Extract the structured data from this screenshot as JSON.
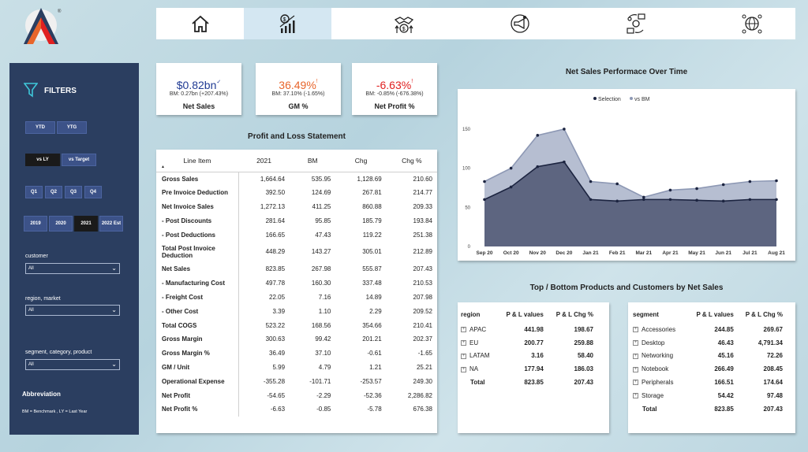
{
  "nav": {
    "items": [
      "home-icon",
      "finance-growth-icon",
      "handshake-growth-icon",
      "marketing-icon",
      "supply-chain-icon",
      "global-network-icon"
    ],
    "active_index": 1
  },
  "filters": {
    "title": "FILTERS",
    "period_buttons": [
      "YTD",
      "YTG"
    ],
    "compare_buttons": [
      "vs LY",
      "vs Target"
    ],
    "compare_selected": "vs LY",
    "quarter_buttons": [
      "Q1",
      "Q2",
      "Q3",
      "Q4"
    ],
    "year_buttons": [
      "2019",
      "2020",
      "2021",
      "2022 Est"
    ],
    "year_selected": "2021",
    "customer_label": "customer",
    "customer_value": "All",
    "region_label": "region, market",
    "region_value": "All",
    "segment_label": "segment, category, product",
    "segment_value": "All",
    "abbrev_title": "Abbreviation",
    "abbrev_text": "BM = Benchmark , LY = Last Year"
  },
  "kpis": [
    {
      "value": "$0.82bn",
      "mark": "✓",
      "bm": "BM: 0.27bn (+207.43%)",
      "label": "Net Sales",
      "color": "#1f3a93"
    },
    {
      "value": "36.49%",
      "mark": "!",
      "bm": "BM: 37.10% (-1.65%)",
      "label": "GM %",
      "color": "#e8652b"
    },
    {
      "value": "-6.63%",
      "mark": "!",
      "bm": "BM: -0.85% (-676.38%)",
      "label": "Net Profit %",
      "color": "#e02020"
    }
  ],
  "pl": {
    "title": "Profit and Loss  Statement",
    "headers": [
      "Line Item",
      "2021",
      "BM",
      "Chg",
      "Chg %"
    ],
    "rows": [
      [
        "Gross Sales",
        "1,664.64",
        "535.95",
        "1,128.69",
        "210.60"
      ],
      [
        "Pre Invoice Deduction",
        "392.50",
        "124.69",
        "267.81",
        "214.77"
      ],
      [
        "Net Invoice Sales",
        "1,272.13",
        "411.25",
        "860.88",
        "209.33"
      ],
      [
        " - Post Discounts",
        "281.64",
        "95.85",
        "185.79",
        "193.84"
      ],
      [
        " - Post Deductions",
        "166.65",
        "47.43",
        "119.22",
        "251.38"
      ],
      [
        "Total Post Invoice Deduction",
        "448.29",
        "143.27",
        "305.01",
        "212.89"
      ],
      [
        "Net Sales",
        "823.85",
        "267.98",
        "555.87",
        "207.43"
      ],
      [
        " - Manufacturing Cost",
        "497.78",
        "160.30",
        "337.48",
        "210.53"
      ],
      [
        " - Freight Cost",
        "22.05",
        "7.16",
        "14.89",
        "207.98"
      ],
      [
        " - Other Cost",
        "3.39",
        "1.10",
        "2.29",
        "209.52"
      ],
      [
        "Total COGS",
        "523.22",
        "168.56",
        "354.66",
        "210.41"
      ],
      [
        "Gross Margin",
        "300.63",
        "99.42",
        "201.21",
        "202.37"
      ],
      [
        "Gross Margin %",
        "36.49",
        "37.10",
        "-0.61",
        "-1.65"
      ],
      [
        "GM / Unit",
        "5.99",
        "4.79",
        "1.21",
        "25.21"
      ],
      [
        "Operational Expense",
        "-355.28",
        "-101.71",
        "-253.57",
        "249.30"
      ],
      [
        "Net Profit",
        "-54.65",
        "-2.29",
        "-52.36",
        "2,286.82"
      ],
      [
        "Net Profit %",
        "-6.63",
        "-0.85",
        "-5.78",
        "676.38"
      ]
    ]
  },
  "chart_title": "Net Sales Performace Over Time",
  "chart_data": {
    "type": "area",
    "categories": [
      "Sep 20",
      "Oct 20",
      "Nov 20",
      "Dec 20",
      "Jan 21",
      "Feb 21",
      "Mar 21",
      "Apr 21",
      "May 21",
      "Jun 21",
      "Jul 21",
      "Aug 21"
    ],
    "series": [
      {
        "name": "Selection",
        "values": [
          60,
          76,
          102,
          108,
          60,
          58,
          60,
          60,
          59,
          58,
          60,
          60
        ],
        "color": "#5d6580"
      },
      {
        "name": "vs BM",
        "values": [
          83,
          100,
          142,
          150,
          83,
          80,
          63,
          72,
          74,
          79,
          83,
          84
        ],
        "color": "#a9b3c9"
      }
    ],
    "yticks": [
      "0",
      "50",
      "100",
      "150"
    ],
    "ylim": [
      0,
      165
    ],
    "legend": "top-center"
  },
  "topbottom_title": "Top / Bottom Products and Customers by Net Sales",
  "region_table": {
    "headers": [
      "region",
      "P & L values",
      "P & L Chg %"
    ],
    "rows": [
      [
        "APAC",
        "441.98",
        "198.67"
      ],
      [
        "EU",
        "200.77",
        "259.88"
      ],
      [
        "LATAM",
        "3.16",
        "58.40"
      ],
      [
        "NA",
        "177.94",
        "186.03"
      ]
    ],
    "total": [
      "Total",
      "823.85",
      "207.43"
    ]
  },
  "segment_table": {
    "headers": [
      "segment",
      "P & L values",
      "P & L Chg %"
    ],
    "rows": [
      [
        "Accessories",
        "244.85",
        "269.67"
      ],
      [
        "Desktop",
        "46.43",
        "4,791.34"
      ],
      [
        "Networking",
        "45.16",
        "72.26"
      ],
      [
        "Notebook",
        "266.49",
        "208.45"
      ],
      [
        "Peripherals",
        "166.51",
        "174.64"
      ],
      [
        "Storage",
        "54.42",
        "97.48"
      ]
    ],
    "total": [
      "Total",
      "823.85",
      "207.43"
    ]
  }
}
